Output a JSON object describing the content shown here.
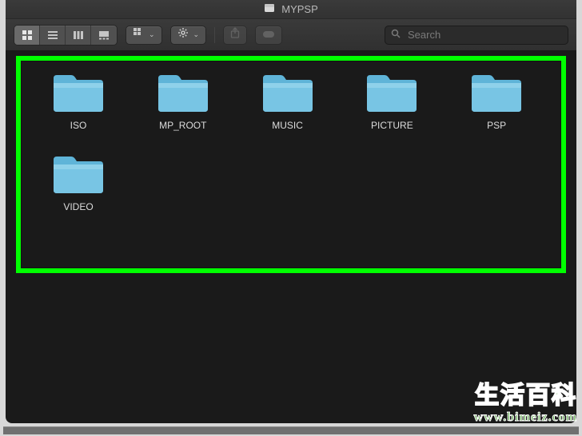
{
  "window": {
    "title": "MYPSP"
  },
  "toolbar": {
    "view_icon_active": "icon-view",
    "search_placeholder": "Search"
  },
  "folders": [
    {
      "name": "ISO"
    },
    {
      "name": "MP_ROOT"
    },
    {
      "name": "MUSIC"
    },
    {
      "name": "PICTURE"
    },
    {
      "name": "PSP"
    },
    {
      "name": "VIDEO"
    }
  ],
  "watermark": {
    "text": "生活百科",
    "url": "www.bimeiz.com"
  }
}
